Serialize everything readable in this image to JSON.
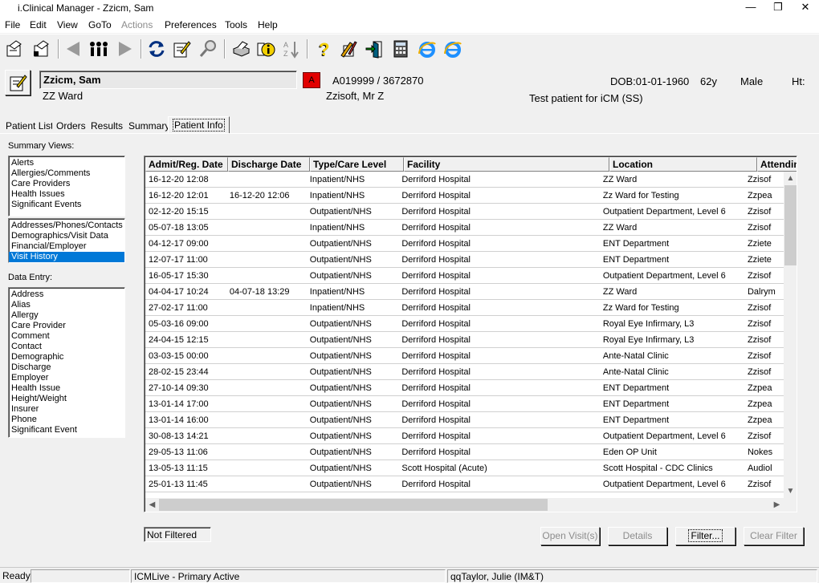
{
  "window": {
    "title": "i.Clinical Manager - Zzicm, Sam"
  },
  "menu": [
    "File",
    "Edit",
    "View",
    "GoTo",
    "Actions",
    "Preferences",
    "Tools",
    "Help"
  ],
  "patient": {
    "name": "Zzicm, Sam",
    "ward": "ZZ Ward",
    "alert": "A",
    "ids": "A019999 / 3672870",
    "consultant": "Zzisoft, Mr Z",
    "dob": "DOB:01-01-1960",
    "age": "62y",
    "sex": "Male",
    "ht": "Ht:",
    "note": "Test patient for iCM (SS)"
  },
  "tabs": [
    "Patient List",
    "Orders",
    "Results",
    "Summary",
    "Patient Info"
  ],
  "summary_views": {
    "label": "Summary Views:",
    "group1": [
      "Alerts",
      "Allergies/Comments",
      "Care Providers",
      "Health Issues",
      "Significant Events"
    ],
    "group2": [
      "Addresses/Phones/Contacts",
      "Demographics/Visit Data",
      "Financial/Employer",
      "Visit History"
    ]
  },
  "data_entry": {
    "label": "Data Entry:",
    "items": [
      "Address",
      "Alias",
      "Allergy",
      "Care Provider",
      "Comment",
      "Contact",
      "Demographic",
      "Discharge",
      "Employer",
      "Health Issue",
      "Height/Weight",
      "Insurer",
      "Phone",
      "Significant Event"
    ]
  },
  "grid": {
    "columns": [
      "Admit/Reg. Date",
      "Discharge Date",
      "Type/Care Level",
      "Facility",
      "Location",
      "Attending"
    ],
    "rows": [
      [
        "16-12-20 12:08",
        "",
        "Inpatient/NHS",
        "Derriford Hospital",
        "ZZ Ward",
        "Zzisof"
      ],
      [
        "16-12-20 12:01",
        "16-12-20 12:06",
        "Inpatient/NHS",
        "Derriford Hospital",
        "Zz Ward for Testing",
        "Zzpea"
      ],
      [
        "02-12-20 15:15",
        "",
        "Outpatient/NHS",
        "Derriford Hospital",
        "Outpatient Department, Level 6",
        "Zzisof"
      ],
      [
        "05-07-18 13:05",
        "",
        "Inpatient/NHS",
        "Derriford Hospital",
        "ZZ Ward",
        "Zzisof"
      ],
      [
        "04-12-17 09:00",
        "",
        "Outpatient/NHS",
        "Derriford Hospital",
        "ENT Department",
        "Zziete"
      ],
      [
        "12-07-17 11:00",
        "",
        "Outpatient/NHS",
        "Derriford Hospital",
        "ENT Department",
        "Zziete"
      ],
      [
        "16-05-17 15:30",
        "",
        "Outpatient/NHS",
        "Derriford Hospital",
        "Outpatient Department, Level 6",
        "Zzisof"
      ],
      [
        "04-04-17 10:24",
        "04-07-18 13:29",
        "Inpatient/NHS",
        "Derriford Hospital",
        "ZZ Ward",
        "Dalrym"
      ],
      [
        "27-02-17 11:00",
        "",
        "Inpatient/NHS",
        "Derriford Hospital",
        "Zz Ward for Testing",
        "Zzisof"
      ],
      [
        "05-03-16 09:00",
        "",
        "Outpatient/NHS",
        "Derriford Hospital",
        "Royal Eye Infirmary, L3",
        "Zzisof"
      ],
      [
        "24-04-15 12:15",
        "",
        "Outpatient/NHS",
        "Derriford Hospital",
        "Royal Eye Infirmary, L3",
        "Zzisof"
      ],
      [
        "03-03-15 00:00",
        "",
        "Outpatient/NHS",
        "Derriford Hospital",
        "Ante-Natal Clinic",
        "Zzisof"
      ],
      [
        "28-02-15 23:44",
        "",
        "Outpatient/NHS",
        "Derriford Hospital",
        "Ante-Natal Clinic",
        "Zzisof"
      ],
      [
        "27-10-14 09:30",
        "",
        "Outpatient/NHS",
        "Derriford Hospital",
        "ENT Department",
        "Zzpea"
      ],
      [
        "13-01-14 17:00",
        "",
        "Outpatient/NHS",
        "Derriford Hospital",
        "ENT Department",
        "Zzpea"
      ],
      [
        "13-01-14 16:00",
        "",
        "Outpatient/NHS",
        "Derriford Hospital",
        "ENT Department",
        "Zzpea"
      ],
      [
        "30-08-13 14:21",
        "",
        "Outpatient/NHS",
        "Derriford Hospital",
        "Outpatient Department, Level 6",
        "Zzisof"
      ],
      [
        "29-05-13 11:06",
        "",
        "Outpatient/NHS",
        "Derriford Hospital",
        "Eden OP Unit",
        "Nokes"
      ],
      [
        "13-05-13 11:15",
        "",
        "Outpatient/NHS",
        "Scott Hospital (Acute)",
        "Scott Hospital - CDC Clinics",
        "Audiol"
      ],
      [
        "25-01-13 11:45",
        "",
        "Outpatient/NHS",
        "Derriford Hospital",
        "Outpatient Department, Level 6",
        "Zzisof"
      ]
    ]
  },
  "filter_status": "Not Filtered",
  "buttons": {
    "open": "Open Visit(s)",
    "details": "Details",
    "filter": "Filter...",
    "clear": "Clear Filter"
  },
  "status": {
    "ready": "Ready",
    "db": "ICMLive - Primary Active",
    "user": "qqTaylor, Julie (IM&T)"
  }
}
